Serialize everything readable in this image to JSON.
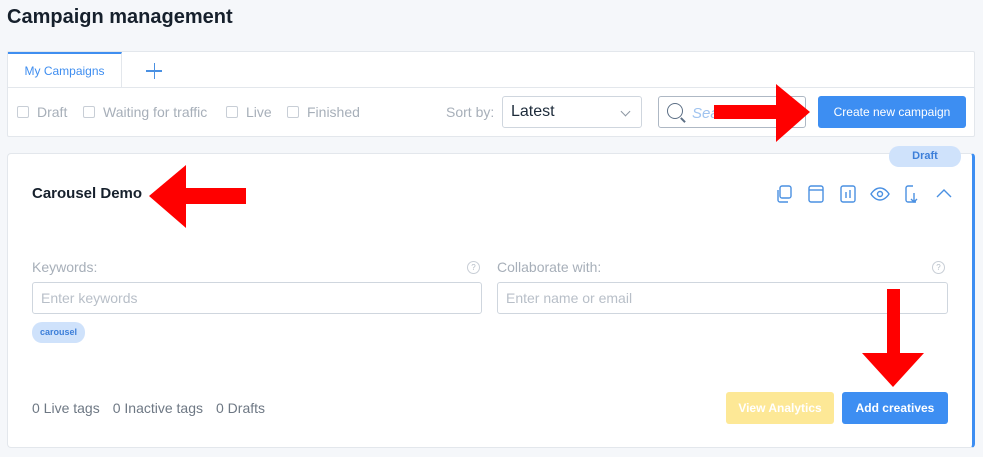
{
  "page": {
    "title": "Campaign management"
  },
  "tabs": {
    "active_label": "My Campaigns",
    "add_icon": "plus-icon"
  },
  "filters": {
    "draft": "Draft",
    "waiting": "Waiting for traffic",
    "live": "Live",
    "finished": "Finished"
  },
  "sort": {
    "label": "Sort by:",
    "value": "Latest"
  },
  "search": {
    "placeholder": "Search"
  },
  "actions": {
    "create_label": "Create new campaign"
  },
  "campaign": {
    "status": "Draft",
    "name": "Carousel Demo",
    "icons": [
      "copy-icon",
      "window-icon",
      "archive-icon",
      "eye-icon",
      "download-icon",
      "chevron-up-icon"
    ],
    "keywords_label": "Keywords:",
    "keywords_placeholder": "Enter keywords",
    "collab_label": "Collaborate with:",
    "collab_placeholder": "Enter name or email",
    "help_glyph": "?",
    "tags": [
      "carousel"
    ],
    "stats": {
      "live": "0 Live tags",
      "inactive": "0 Inactive tags",
      "drafts": "0 Drafts"
    },
    "analytics_label": "View Analytics",
    "add_label": "Add creatives"
  },
  "colors": {
    "accent": "#3d8ef2",
    "annotation_arrow": "#ff0000",
    "analytics_disabled": "#fde896"
  }
}
